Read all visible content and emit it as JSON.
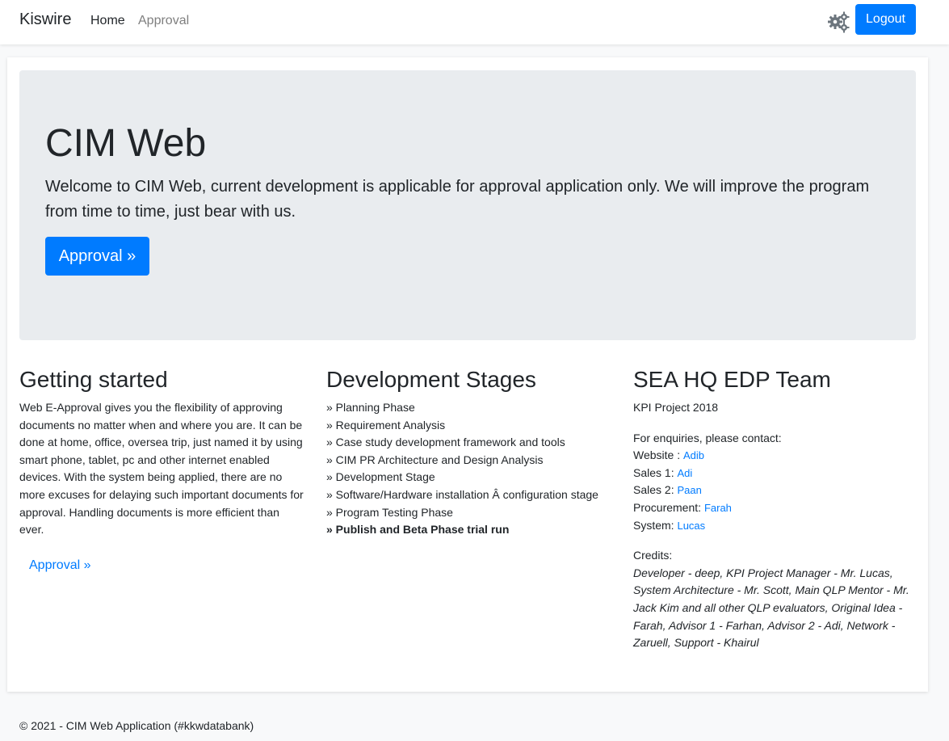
{
  "navbar": {
    "brand": "Kiswire",
    "links": [
      "Home",
      "Approval"
    ],
    "logout_label": "Logout"
  },
  "jumbotron": {
    "title": "CIM Web",
    "lead": "Welcome to CIM Web, current development is applicable for approval application only. We will improve the program from time to time, just bear with us.",
    "button_label": "Approval »"
  },
  "getting_started": {
    "heading": "Getting started",
    "body": "Web E-Approval gives you the flexibility of approving documents no matter when and where you are. It can be done at home, office, oversea trip, just named it by using smart phone, tablet, pc and other internet enabled devices. With the system being applied, there are no more excuses for delaying such important documents for approval. Handling documents is more efficient than ever.",
    "link_label": "Approval »"
  },
  "dev_stages": {
    "heading": "Development Stages",
    "items": [
      "» Planning Phase",
      "» Requirement Analysis",
      "» Case study development framework and tools",
      "» CIM PR Architecture and Design Analysis",
      "» Development Stage",
      "» Software/Hardware installation Â configuration stage",
      "» Program Testing Phase",
      "» Publish and Beta Phase trial run"
    ]
  },
  "team": {
    "heading": "SEA HQ EDP Team",
    "project": "KPI Project 2018",
    "enquiries": "For enquiries, please contact:",
    "contacts": [
      {
        "label": "Website : ",
        "name": "Adib"
      },
      {
        "label": "Sales 1: ",
        "name": "Adi"
      },
      {
        "label": "Sales 2: ",
        "name": "Paan"
      },
      {
        "label": "Procurement: ",
        "name": "Farah"
      },
      {
        "label": "System: ",
        "name": "Lucas"
      }
    ],
    "credits_label": "Credits:",
    "credits": "Developer - deep, KPI Project Manager - Mr. Lucas, System Architecture - Mr. Scott, Main QLP Mentor - Mr. Jack Kim and all other QLP evaluators, Original Idea - Farah, Advisor 1 - Farhan, Advisor 2 - Adi, Network - Zaruell, Support - Khairul"
  },
  "footer": "© 2021 - CIM Web Application (#kkwdatabank)",
  "colors": {
    "primary": "#007bff",
    "jumbotron_bg": "#e9ecef",
    "page_bg": "#f8f9fa",
    "icon_gray": "#6c757d"
  },
  "icons": {
    "settings": "gears-icon"
  }
}
